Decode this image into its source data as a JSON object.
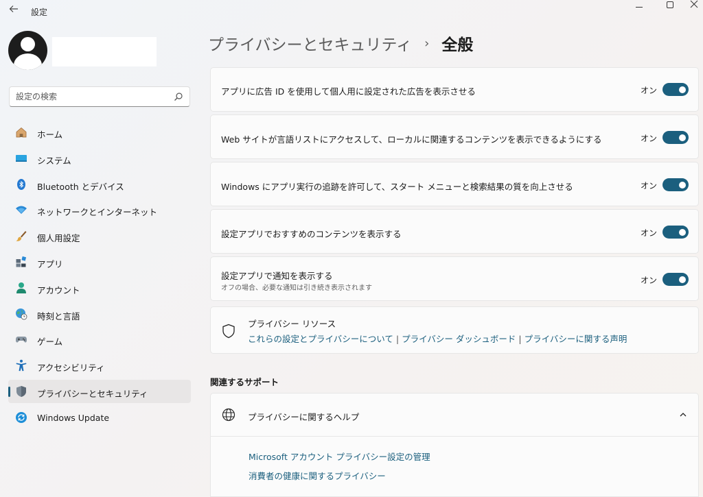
{
  "window": {
    "title": "設定"
  },
  "search": {
    "placeholder": "設定の検索"
  },
  "sidebar": {
    "items": [
      {
        "label": "ホーム",
        "icon": "home-icon"
      },
      {
        "label": "システム",
        "icon": "system-icon"
      },
      {
        "label": "Bluetooth とデバイス",
        "icon": "bluetooth-icon"
      },
      {
        "label": "ネットワークとインターネット",
        "icon": "wifi-icon"
      },
      {
        "label": "個人用設定",
        "icon": "brush-icon"
      },
      {
        "label": "アプリ",
        "icon": "apps-icon"
      },
      {
        "label": "アカウント",
        "icon": "account-icon"
      },
      {
        "label": "時刻と言語",
        "icon": "globe-clock-icon"
      },
      {
        "label": "ゲーム",
        "icon": "gamepad-icon"
      },
      {
        "label": "アクセシビリティ",
        "icon": "accessibility-icon"
      },
      {
        "label": "プライバシーとセキュリティ",
        "icon": "shield-icon",
        "active": true
      },
      {
        "label": "Windows Update",
        "icon": "update-icon"
      }
    ]
  },
  "header": {
    "parent": "プライバシーとセキュリティ",
    "separator": "›",
    "current": "全般"
  },
  "settings": [
    {
      "label": "アプリに広告 ID を使用して個人用に設定された広告を表示させる",
      "state": "オン",
      "on": true
    },
    {
      "label": "Web サイトが言語リストにアクセスして、ローカルに関連するコンテンツを表示できるようにする",
      "state": "オン",
      "on": true
    },
    {
      "label": "Windows にアプリ実行の追跡を許可して、スタート メニューと検索結果の質を向上させる",
      "state": "オン",
      "on": true
    },
    {
      "label": "設定アプリでおすすめのコンテンツを表示する",
      "state": "オン",
      "on": true
    },
    {
      "label": "設定アプリで通知を表示する",
      "sub": "オフの場合、必要な通知は引き続き表示されます",
      "state": "オン",
      "on": true
    }
  ],
  "resources": {
    "title": "プライバシー リソース",
    "links": [
      "これらの設定とプライバシーについて",
      "プライバシー ダッシュボード",
      "プライバシーに関する声明"
    ],
    "separator": "|"
  },
  "related": {
    "title": "関連するサポート",
    "help_title": "プライバシーに関するヘルプ",
    "links": [
      "Microsoft アカウント プライバシー設定の管理",
      "消費者の健康に関するプライバシー"
    ]
  },
  "colors": {
    "accent": "#1b5f7e"
  }
}
